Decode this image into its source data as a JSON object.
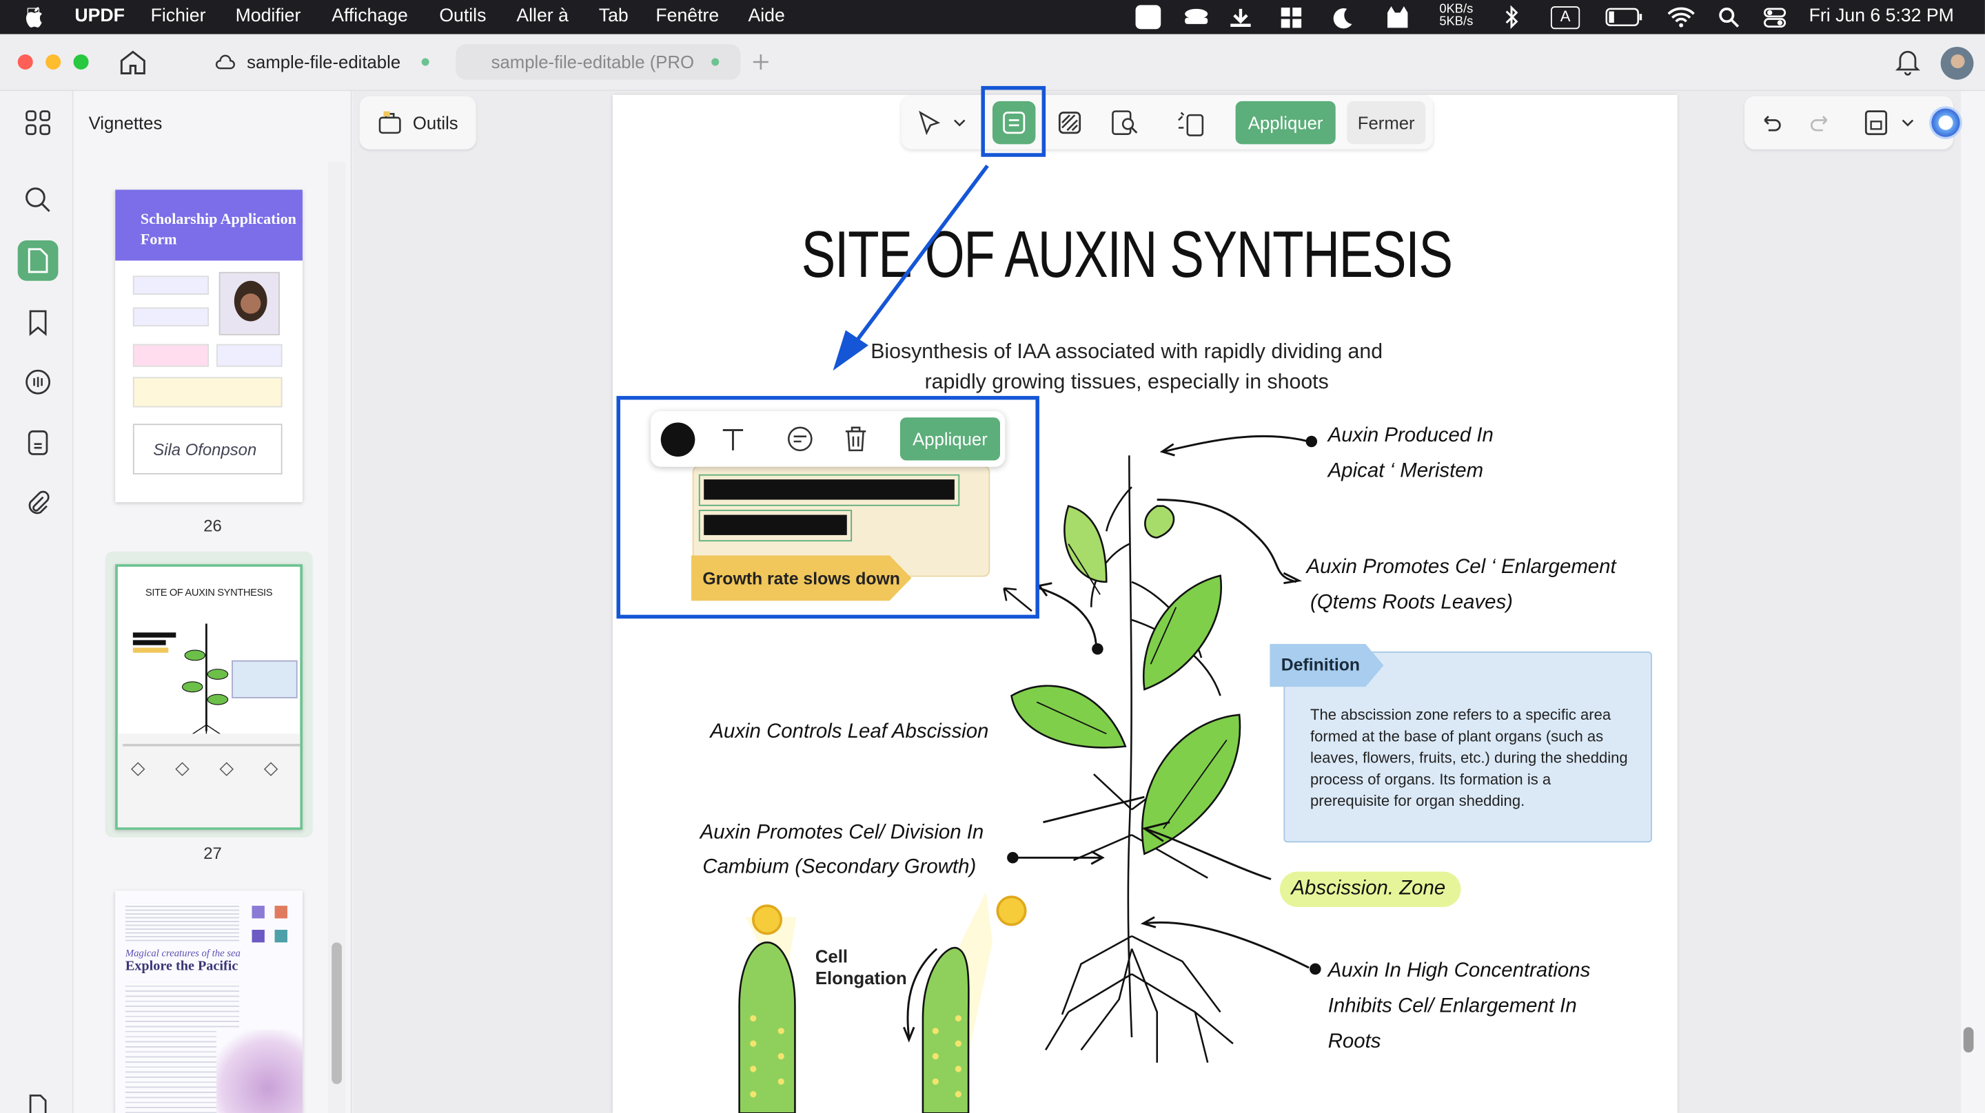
{
  "menubar": {
    "app": "UPDF",
    "items": [
      "Fichier",
      "Modifier",
      "Affichage",
      "Outils",
      "Aller à",
      "Tab",
      "Fenêtre",
      "Aide"
    ],
    "net_up": "0KB/s",
    "net_down": "5KB/s",
    "datetime": "Fri Jun 6  5:32 PM"
  },
  "tabs": [
    {
      "label": "sample-file-editable"
    },
    {
      "label": "sample-file-editable (PRO"
    }
  ],
  "sidebar": {
    "title": "Vignettes",
    "tools_label": "Outils"
  },
  "thumbnails": [
    {
      "page": "26",
      "title": "Scholarship Application Form",
      "signature": "Sila Ofonpson"
    },
    {
      "page": "27",
      "title": "SITE OF AUXIN SYNTHESIS"
    },
    {
      "page": "28",
      "title": "Explore the Pacific",
      "subtitle": "Magical creatures of the sea"
    }
  ],
  "toolbar": {
    "apply": "Appliquer",
    "close": "Fermer"
  },
  "popup": {
    "apply": "Appliquer"
  },
  "doc": {
    "title": "SITE OF AUXIN SYNTHESIS",
    "subtitle_line1": "Biosynthesis of IAA associated with rapidly dividing and",
    "subtitle_line2": "rapidly growing tissues, especially in shoots",
    "growth_tag": "Growth rate slows down",
    "label_produced_1": "Auxin Produced In",
    "label_produced_2": "Apicat ‘ Meristem",
    "label_enlarge_1": "Auxin Promotes Cel ‘ Enlargement",
    "label_enlarge_2": "(Qtems Roots Leaves)",
    "definition_tag": "Definition",
    "definition_text": "The abscission zone refers to a specific area formed at the base of plant organs (such as leaves, flowers, fruits, etc.) during the shedding process of organs. Its formation is a prerequisite for organ shedding.",
    "label_abscission": "Auxin Controls Leaf Abscission",
    "label_division_1": "Auxin Promotes Cel/ Division In",
    "label_division_2": "Cambium (Secondary Growth)",
    "zone_tag": "Abscission. Zone",
    "cell_1": "Cell",
    "cell_2": "Elongation",
    "label_high_1": "Auxin In High Concentrations",
    "label_high_2": "Inhibits Cel/ Enlargement In",
    "label_high_3": "Roots"
  },
  "colors": {
    "accent_green": "#5cae7a",
    "highlight_blue": "#1556d6",
    "tag_yellow": "#f1c75b",
    "def_blue": "#dbe9f7"
  }
}
